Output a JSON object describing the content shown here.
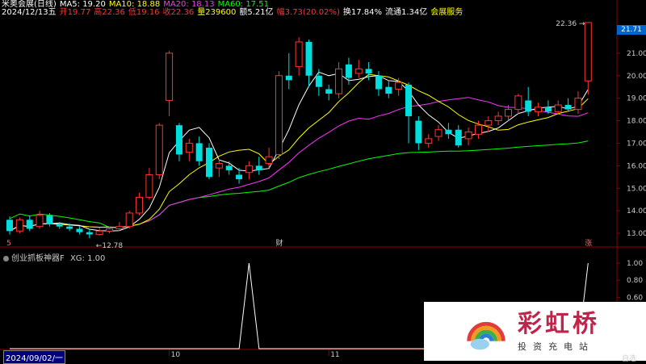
{
  "header": {
    "row1": [
      {
        "text": "米奥会展(日线)",
        "color": "#ffffff"
      },
      {
        "text": "MA5: 19.20",
        "color": "#ffffff"
      },
      {
        "text": "MA10: 18.88",
        "color": "#ffff00"
      },
      {
        "text": "MA20: 18.13",
        "color": "#ff33ff"
      },
      {
        "text": "MA60: 17.51",
        "color": "#00ff00"
      }
    ],
    "row2": [
      {
        "text": "2024/12/13五",
        "color": "#ffffff"
      },
      {
        "text": "开19.77",
        "color": "#ff3333"
      },
      {
        "text": "高22.36",
        "color": "#ff3333"
      },
      {
        "text": "低19.16",
        "color": "#ff3333"
      },
      {
        "text": "收22.36",
        "color": "#ff3333"
      },
      {
        "text": "量239600",
        "color": "#ffff00"
      },
      {
        "text": "额5.21亿",
        "color": "#ffffff"
      },
      {
        "text": "幅3.73(20.02%)",
        "color": "#ff3333"
      },
      {
        "text": "换17.84%",
        "color": "#ffffff"
      },
      {
        "text": "流通1.34亿",
        "color": "#ffffff"
      },
      {
        "text": "会展服务",
        "color": "#ffff00"
      }
    ]
  },
  "indicator": {
    "title": "创业抓板神器F",
    "xg_label": "XG: 1.00"
  },
  "date_box": "2024/09/02/一",
  "price_tag": "21.71",
  "bottom_tag": "自选",
  "watermark": {
    "brand": "彩虹桥",
    "sub": "投资充电站"
  },
  "chart_data": {
    "type": "candlestick",
    "y_axis": {
      "min": 12.5,
      "max": 22.5,
      "ticks": [
        13.0,
        14.0,
        15.0,
        16.0,
        17.0,
        18.0,
        19.0,
        20.0,
        21.0
      ]
    },
    "indicator_axis": {
      "min": 0,
      "max": 1,
      "ticks": [
        1.0,
        0.8,
        0.6
      ]
    },
    "x_labels": [
      {
        "index": 16,
        "text": "10"
      },
      {
        "index": 32,
        "text": "11"
      }
    ],
    "annotations": [
      {
        "index": 8,
        "price": 12.78,
        "text": "12.78"
      },
      {
        "index": 58,
        "price": 22.36,
        "text": "22.36"
      },
      {
        "index": 27,
        "text": "财"
      },
      {
        "index": 58,
        "text": "涨"
      },
      {
        "index": 0,
        "text": "5"
      }
    ],
    "candles": [
      [
        13.6,
        13.1,
        13.75,
        12.95
      ],
      [
        13.1,
        13.6,
        13.7,
        13.0
      ],
      [
        13.6,
        13.2,
        13.8,
        13.1
      ],
      [
        13.3,
        13.8,
        14.0,
        13.2
      ],
      [
        13.8,
        13.4,
        13.9,
        13.3
      ],
      [
        13.4,
        13.3,
        13.5,
        13.2
      ],
      [
        13.3,
        13.2,
        13.45,
        13.1
      ],
      [
        13.2,
        13.05,
        13.3,
        12.95
      ],
      [
        13.05,
        12.95,
        13.2,
        12.78
      ],
      [
        12.95,
        13.1,
        13.25,
        12.9
      ],
      [
        13.1,
        13.2,
        13.3,
        13.0
      ],
      [
        13.2,
        13.3,
        13.5,
        13.1
      ],
      [
        13.3,
        13.9,
        14.0,
        13.2
      ],
      [
        13.9,
        14.6,
        14.8,
        13.8
      ],
      [
        14.6,
        15.6,
        15.9,
        14.5
      ],
      [
        15.6,
        17.8,
        17.9,
        15.4
      ],
      [
        18.9,
        21.0,
        21.1,
        18.2
      ],
      [
        17.8,
        16.5,
        17.9,
        16.2
      ],
      [
        16.6,
        17.0,
        17.2,
        16.2
      ],
      [
        17.0,
        16.2,
        17.3,
        16.0
      ],
      [
        16.8,
        15.5,
        17.0,
        15.4
      ],
      [
        15.9,
        16.1,
        16.3,
        15.5
      ],
      [
        16.0,
        15.8,
        16.2,
        15.6
      ],
      [
        15.6,
        15.4,
        15.9,
        15.2
      ],
      [
        15.7,
        16.0,
        16.2,
        15.4
      ],
      [
        16.0,
        15.8,
        16.4,
        15.6
      ],
      [
        16.1,
        16.4,
        16.8,
        15.9
      ],
      [
        16.5,
        20.0,
        20.2,
        16.3
      ],
      [
        20.0,
        19.8,
        21.0,
        19.4
      ],
      [
        20.4,
        21.5,
        21.7,
        20.0
      ],
      [
        21.5,
        20.0,
        21.6,
        19.5
      ],
      [
        20.0,
        19.5,
        20.3,
        19.1
      ],
      [
        19.4,
        19.2,
        19.6,
        18.9
      ],
      [
        19.2,
        20.3,
        20.6,
        19.0
      ],
      [
        20.5,
        19.9,
        20.8,
        19.6
      ],
      [
        20.1,
        20.3,
        20.7,
        19.9
      ],
      [
        20.3,
        20.1,
        20.6,
        19.8
      ],
      [
        20.0,
        19.4,
        20.2,
        19.1
      ],
      [
        19.5,
        19.2,
        19.8,
        19.0
      ],
      [
        19.4,
        19.7,
        19.9,
        19.1
      ],
      [
        19.6,
        18.2,
        19.7,
        17.0
      ],
      [
        18.0,
        17.0,
        18.2,
        16.7
      ],
      [
        17.0,
        17.2,
        17.4,
        16.8
      ],
      [
        17.3,
        17.6,
        17.8,
        17.1
      ],
      [
        17.6,
        17.4,
        17.9,
        17.2
      ],
      [
        17.6,
        16.9,
        17.8,
        16.8
      ],
      [
        17.2,
        17.5,
        17.7,
        16.9
      ],
      [
        17.4,
        17.8,
        18.0,
        17.2
      ],
      [
        17.8,
        18.0,
        18.2,
        17.5
      ],
      [
        18.0,
        18.2,
        18.4,
        17.8
      ],
      [
        18.2,
        18.5,
        18.7,
        18.0
      ],
      [
        18.5,
        19.1,
        19.2,
        18.3
      ],
      [
        18.9,
        18.4,
        19.5,
        18.2
      ],
      [
        18.4,
        18.6,
        18.8,
        18.2
      ],
      [
        18.6,
        18.4,
        18.9,
        18.3
      ],
      [
        18.4,
        18.7,
        18.9,
        18.3
      ],
      [
        18.7,
        18.5,
        19.0,
        18.4
      ],
      [
        18.5,
        19.0,
        19.3,
        18.3
      ],
      [
        19.77,
        22.36,
        22.36,
        19.16
      ]
    ],
    "xg_signal": [
      {
        "index": 0,
        "value": 0
      },
      {
        "index": 23,
        "value": 0
      },
      {
        "index": 24,
        "value": 1
      },
      {
        "index": 25,
        "value": 0
      },
      {
        "index": 57,
        "value": 0
      },
      {
        "index": 58,
        "value": 1
      }
    ],
    "series_colors": {
      "up": "#ff3333",
      "down": "#00dddd",
      "ma5": "#ffffff",
      "ma10": "#ffff00",
      "ma20": "#ff33ff",
      "ma60": "#00ff00"
    }
  }
}
